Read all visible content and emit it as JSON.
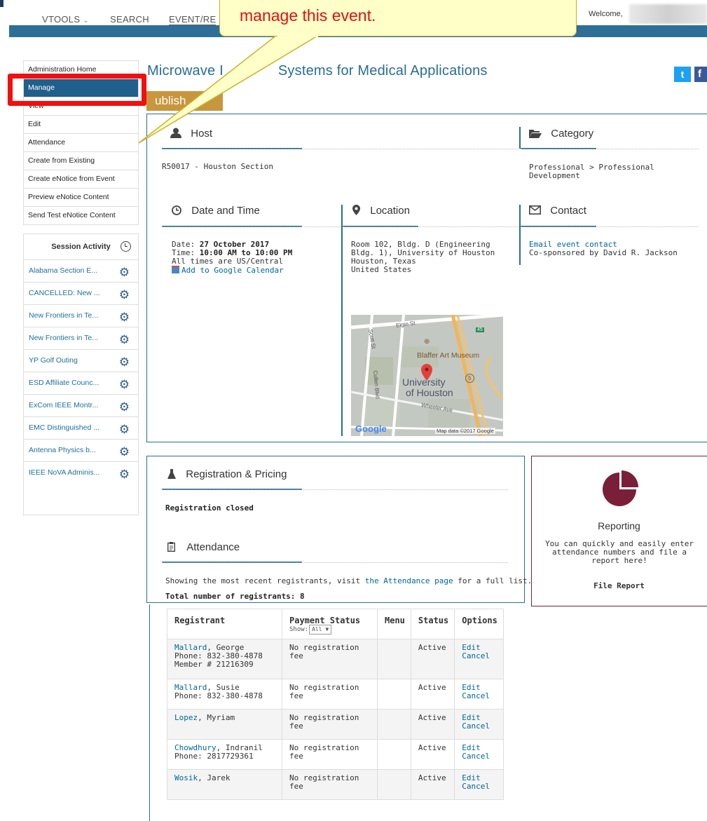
{
  "nav": {
    "items": [
      "VTOOLS",
      "SEARCH",
      "EVENT/RE"
    ],
    "vtools_chevron": "⌄",
    "welcome": "Welcome,"
  },
  "annotation": {
    "callout_text": "manage this event."
  },
  "sidebar": {
    "items": [
      "Administration Home",
      "Manage",
      "View",
      "Edit",
      "Attendance",
      "Create from Existing",
      "Create eNotice from Event",
      "Preview eNotice Content",
      "Send Test eNotice Content"
    ],
    "active_index": 1,
    "session_title": "Session Activity",
    "sessions": [
      "Alabama Section E...",
      "CANCELLED: New ...",
      "New Frontiers in Te...",
      "New Frontiers in Te...",
      "YP Golf Outing",
      "ESD Affiliate Counc...",
      "ExCom IEEE Montr...",
      "EMC Distinguished ...",
      "Antenna Physics b...",
      "IEEE NoVA Adminis..."
    ]
  },
  "event": {
    "title_left": "Microwave I",
    "title_right": "Systems for Medical Applications",
    "publish_label": "ublish"
  },
  "host": {
    "heading": "Host",
    "value": "R50017 - Houston Section"
  },
  "category": {
    "heading": "Category",
    "line1": "Professional > Professional",
    "line2": "Development"
  },
  "datetime": {
    "heading": "Date and Time",
    "date_label": "Date:",
    "date_value": "27 October 2017",
    "time_label": "Time:",
    "time_value": "10:00 AM to 10:00 PM",
    "tz_note": "All times are US/Central",
    "calendar_link": "Add to Google Calendar"
  },
  "location": {
    "heading": "Location",
    "lines": [
      "Room 102, Bldg. D (Engineering",
      "Bldg. 1), University of Houston",
      "Houston, Texas",
      "United States"
    ]
  },
  "contact": {
    "heading": "Contact",
    "link": "Email event contact",
    "cosponsor": "Co-sponsored by David R. Jackson"
  },
  "map": {
    "labels": [
      "Elgin St",
      "Scott St",
      "Blaffer Art Museum",
      "University",
      "of Houston",
      "Cullen Blvd",
      "Wheeler Ave"
    ],
    "highway": "45",
    "route": "5",
    "logo": "Google",
    "credit": "Map data ©2017 Google"
  },
  "registration": {
    "heading": "Registration & Pricing",
    "status": "Registration closed"
  },
  "attendance": {
    "heading": "Attendance",
    "intro_before": "Showing the most recent registrants, visit ",
    "intro_link": "the Attendance page",
    "intro_after": " for a full list.",
    "total": "Total number of registrants: 8"
  },
  "reporting": {
    "heading": "Reporting",
    "body": "You can quickly and easily enter attendance numbers and file a report here!",
    "link": "File Report"
  },
  "table": {
    "headers": [
      "Registrant",
      "Payment Status",
      "Menu",
      "Status",
      "Options"
    ],
    "show_label": "Show:",
    "show_value": "All",
    "rows": [
      {
        "last": "Mallard",
        "first": ", George",
        "extra": [
          "Phone: 832-380-4878",
          "Member # 21216309"
        ],
        "payment": "No registration fee",
        "menu": "",
        "status": "Active",
        "opt1": "Edit",
        "opt2": "Cancel"
      },
      {
        "last": "Mallard",
        "first": ", Susie",
        "extra": [
          "Phone: 832-380-4878"
        ],
        "payment": "No registration fee",
        "menu": "",
        "status": "Active",
        "opt1": "Edit",
        "opt2": "Cancel"
      },
      {
        "last": "Lopez",
        "first": ", Myriam",
        "extra": [],
        "payment": "No registration fee",
        "menu": "",
        "status": "Active",
        "opt1": "Edit",
        "opt2": "Cancel"
      },
      {
        "last": "Chowdhury",
        "first": ", Indranil",
        "extra": [
          "Phone: 2817729361"
        ],
        "payment": "No registration fee",
        "menu": "",
        "status": "Active",
        "opt1": "Edit",
        "opt2": "Cancel"
      },
      {
        "last": "Wosik",
        "first": ", Jarek",
        "extra": [],
        "payment": "No registration fee",
        "menu": "",
        "status": "Active",
        "opt1": "Edit",
        "opt2": "Cancel"
      }
    ]
  },
  "colors": {
    "brand_blue": "#2a6d95",
    "highlight_red": "#f20f0f",
    "reporting_maroon": "#7a1f3a"
  }
}
